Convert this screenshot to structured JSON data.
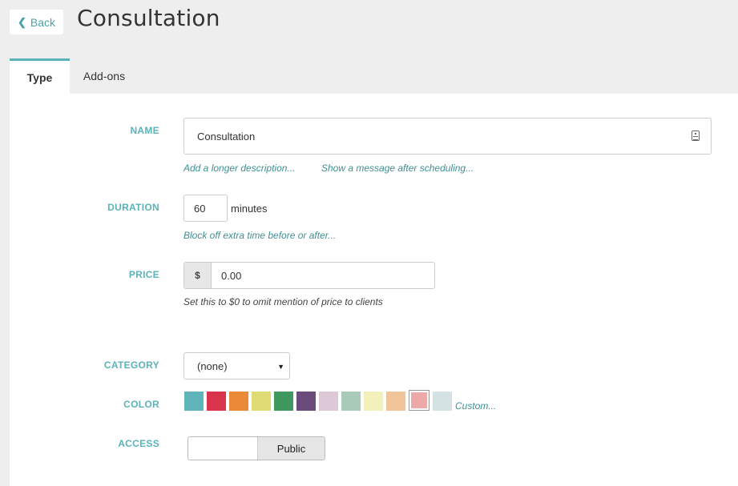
{
  "header": {
    "back_label": "Back",
    "title": "Consultation"
  },
  "tabs": [
    {
      "label": "Type"
    },
    {
      "label": "Add-ons"
    }
  ],
  "form": {
    "name": {
      "label": "NAME",
      "value": "Consultation",
      "link_description": "Add a longer description...",
      "link_message": "Show a message after scheduling..."
    },
    "duration": {
      "label": "DURATION",
      "value": "60",
      "unit": "minutes",
      "link_block": "Block off extra time before or after..."
    },
    "price": {
      "label": "PRICE",
      "currency": "$",
      "value": "0.00",
      "hint": "Set this to $0 to omit mention of price to clients"
    },
    "category": {
      "label": "CATEGORY",
      "selected": "(none)"
    },
    "color": {
      "label": "COLOR",
      "swatches": [
        "#5fb4ba",
        "#d9344d",
        "#ea8a38",
        "#e1db75",
        "#3f9860",
        "#6b4b7c",
        "#dcc8d6",
        "#a9cab8",
        "#f2f1b9",
        "#f2c49a",
        "#eda8a8",
        "#d5e2e3"
      ],
      "selected_index": 10,
      "custom_label": "Custom..."
    },
    "access": {
      "label": "ACCESS",
      "option_right": "Public"
    }
  }
}
